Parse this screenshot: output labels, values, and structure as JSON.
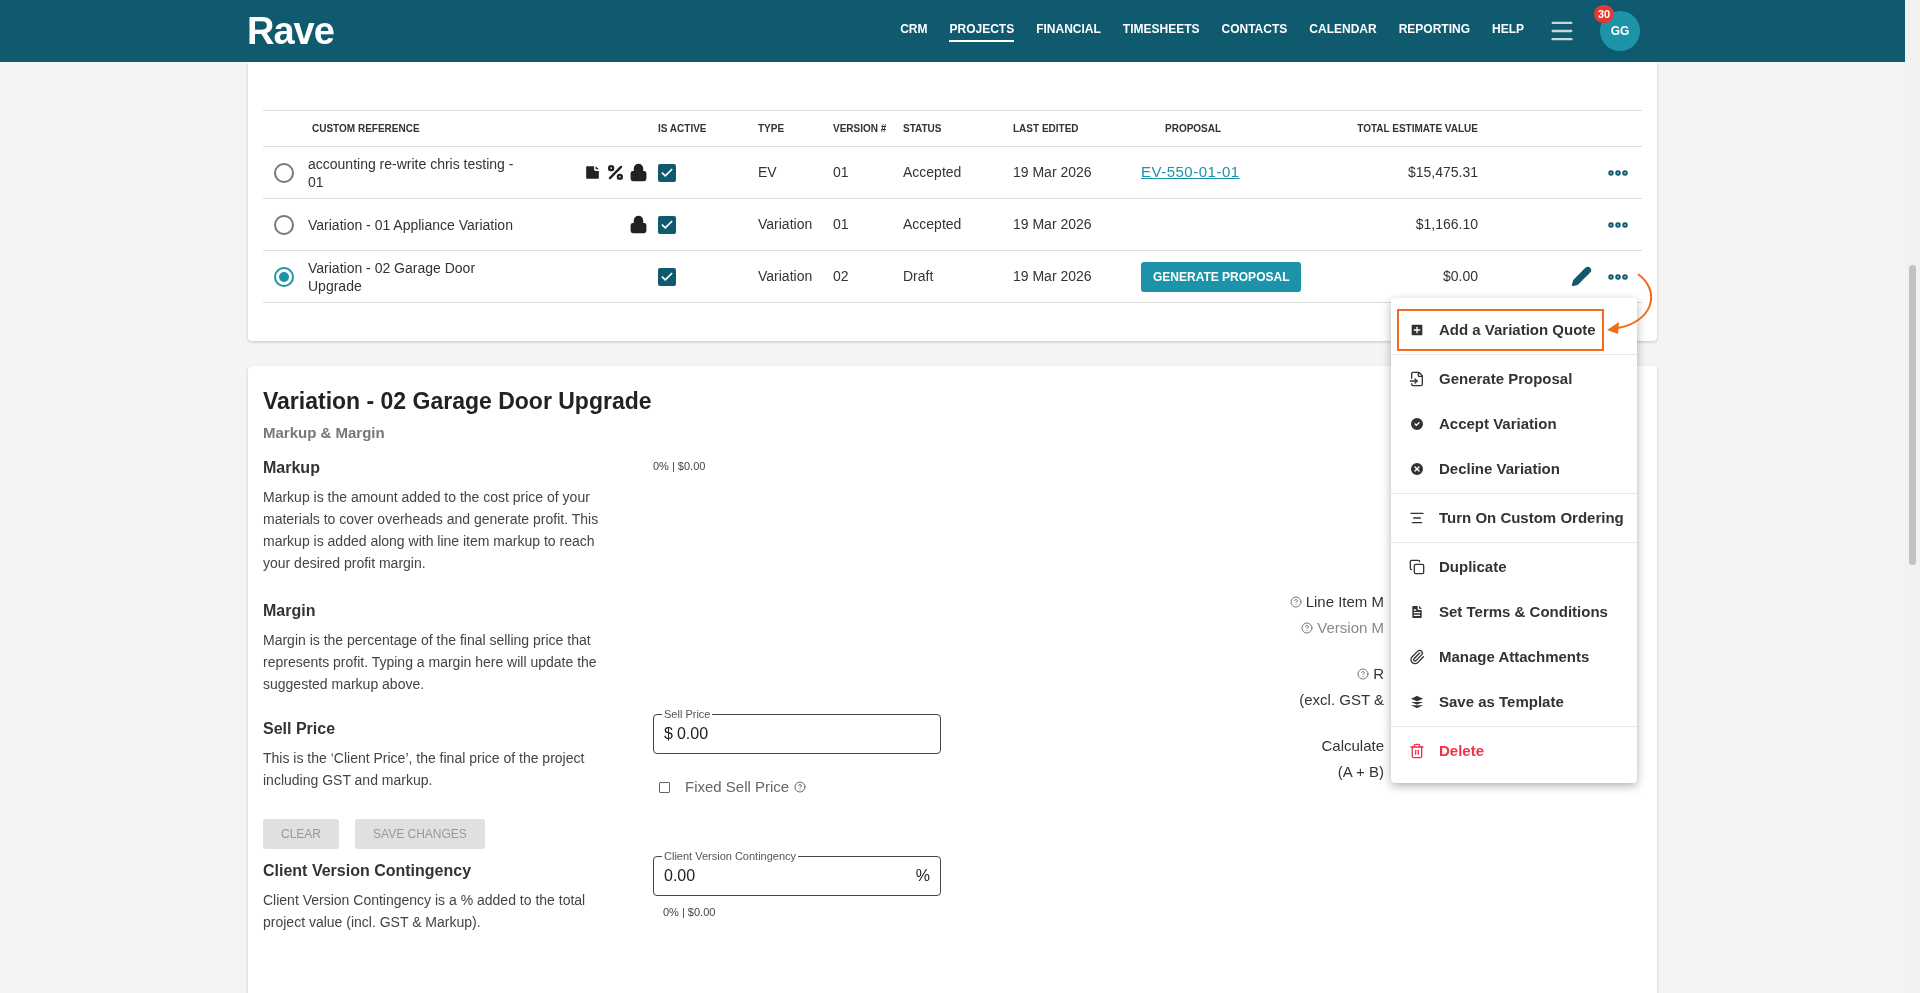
{
  "header": {
    "logo": "Rave",
    "nav": [
      {
        "label": "CRM",
        "selected": false
      },
      {
        "label": "PROJECTS",
        "selected": true
      },
      {
        "label": "FINANCIAL",
        "selected": false
      },
      {
        "label": "TIMESHEETS",
        "selected": false
      },
      {
        "label": "CONTACTS",
        "selected": false
      },
      {
        "label": "CALENDAR",
        "selected": false
      },
      {
        "label": "REPORTING",
        "selected": false
      },
      {
        "label": "HELP",
        "selected": false
      }
    ],
    "notification_count": "30",
    "avatar": "GG"
  },
  "table": {
    "columns": [
      "CUSTOM REFERENCE",
      "IS ACTIVE",
      "TYPE",
      "VERSION #",
      "STATUS",
      "LAST EDITED",
      "PROPOSAL",
      "TOTAL ESTIMATE VALUE"
    ],
    "rows": [
      {
        "selected": false,
        "reference": "accounting re-write chris testing - 01",
        "has_notes": true,
        "has_markup": true,
        "locked": true,
        "active": true,
        "type": "EV",
        "version": "01",
        "status": "Accepted",
        "last_edited": "19 Mar 2026",
        "proposal": {
          "kind": "link",
          "text": "EV-550-01-01"
        },
        "total": "$15,475.31",
        "editable": false
      },
      {
        "selected": false,
        "reference": "Variation - 01 Appliance Variation",
        "has_notes": false,
        "has_markup": false,
        "locked": true,
        "active": true,
        "type": "Variation",
        "version": "01",
        "status": "Accepted",
        "last_edited": "19 Mar 2026",
        "total": "$1,166.10",
        "editable": false
      },
      {
        "selected": true,
        "reference": "Variation - 02 Garage Door Upgrade",
        "has_notes": false,
        "has_markup": false,
        "locked": false,
        "active": true,
        "type": "Variation",
        "version": "02",
        "status": "Draft",
        "last_edited": "19 Mar 2026",
        "proposal": {
          "kind": "button",
          "text": "GENERATE PROPOSAL"
        },
        "total": "$0.00",
        "editable": true
      }
    ]
  },
  "menu": {
    "items": [
      {
        "label": "Add a Variation Quote",
        "highlighted": true,
        "danger": false,
        "divider_before": false
      },
      {
        "label": "Generate Proposal",
        "highlighted": false,
        "danger": false,
        "divider_before": true
      },
      {
        "label": "Accept Variation",
        "highlighted": false,
        "danger": false,
        "divider_before": false
      },
      {
        "label": "Decline Variation",
        "highlighted": false,
        "danger": false,
        "divider_before": false
      },
      {
        "label": "Turn On Custom Ordering",
        "highlighted": false,
        "danger": false,
        "divider_before": true
      },
      {
        "label": "Duplicate",
        "highlighted": false,
        "danger": false,
        "divider_before": true
      },
      {
        "label": "Set Terms & Conditions",
        "highlighted": false,
        "danger": false,
        "divider_before": false
      },
      {
        "label": "Manage Attachments",
        "highlighted": false,
        "danger": false,
        "divider_before": false
      },
      {
        "label": "Save as Template",
        "highlighted": false,
        "danger": false,
        "divider_before": false
      },
      {
        "label": "Delete",
        "highlighted": false,
        "danger": true,
        "divider_before": true
      }
    ]
  },
  "version_panel": {
    "title": "Variation - 02 Garage Door Upgrade",
    "subtitle": "Markup & Margin",
    "markup": {
      "heading": "Markup",
      "text": "Markup is the amount added to the cost price of your materials to cover overheads and generate profit. This markup is added along with line item markup to reach your desired profit margin.",
      "reading": "0% | $0.00"
    },
    "margin": {
      "heading": "Margin",
      "text": "Margin is the percentage of the final selling price that represents profit. Typing a margin here will update the suggested markup above."
    },
    "sell_price": {
      "heading": "Sell Price",
      "text": "This is the ‘Client Price’, the final price of the project including GST and markup.",
      "field": {
        "label": "Sell Price",
        "prefix": "$",
        "value": "0.00"
      },
      "checkbox": {
        "label": "Fixed Sell Price",
        "checked": false
      }
    },
    "buttons": [
      {
        "label": "CLEAR",
        "disabled": true
      },
      {
        "label": "SAVE CHANGES",
        "disabled": true
      }
    ],
    "contingency": {
      "heading": "Client Version Contingency",
      "text": "Client Version Contingency is a % added to the total project value (incl. GST & Markup).",
      "field": {
        "label": "Client Version Contingency",
        "value": "0.00",
        "suffix": "%"
      },
      "reading": "0% | $0.00"
    },
    "summary": [
      {
        "text": "Line Item M",
        "help": true,
        "muted": false
      },
      {
        "text": "Version M",
        "help": true,
        "muted": true
      },
      {
        "text": "R",
        "help": true,
        "muted": false
      },
      {
        "text": "(excl. GST &",
        "help": false,
        "muted": false
      },
      {
        "text": "Calculate",
        "help": false,
        "muted": false
      },
      {
        "text": "(A + B)",
        "help": false,
        "muted": false
      }
    ]
  }
}
